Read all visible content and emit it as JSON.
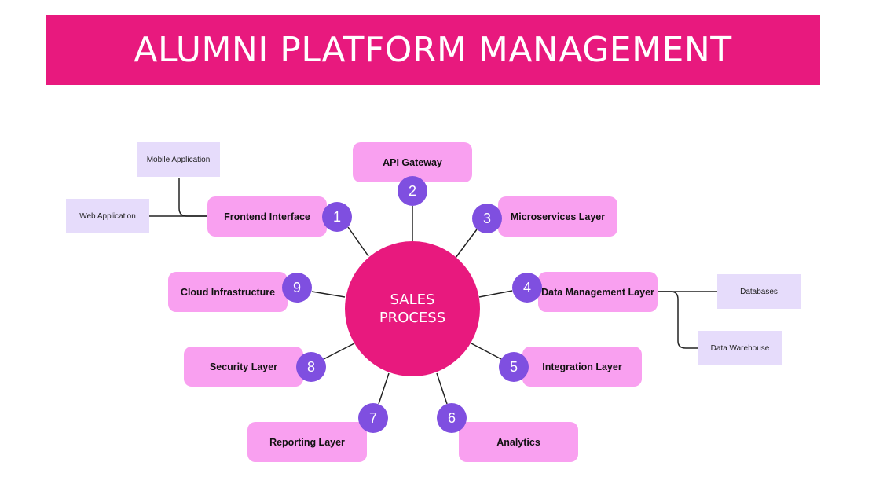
{
  "title": "ALUMNI PLATFORM MANAGEMENT",
  "center": "SALES\nPROCESS",
  "colors": {
    "banner": "#e8197e",
    "hub": "#e8197e",
    "node": "#f9a0f0",
    "badge": "#7f4fe0",
    "leaf": "#e6dcfb"
  },
  "nodes": [
    {
      "num": "1",
      "label": "Frontend Interface"
    },
    {
      "num": "2",
      "label": "API Gateway"
    },
    {
      "num": "3",
      "label": "Microservices Layer"
    },
    {
      "num": "4",
      "label": "Data Management Layer"
    },
    {
      "num": "5",
      "label": "Integration Layer"
    },
    {
      "num": "6",
      "label": "Analytics"
    },
    {
      "num": "7",
      "label": "Reporting Layer"
    },
    {
      "num": "8",
      "label": "Security Layer"
    },
    {
      "num": "9",
      "label": "Cloud Infrastructure"
    }
  ],
  "sub_items": {
    "frontend": [
      "Mobile Application",
      "Web Application"
    ],
    "data": [
      "Databases",
      "Data Warehouse"
    ]
  }
}
